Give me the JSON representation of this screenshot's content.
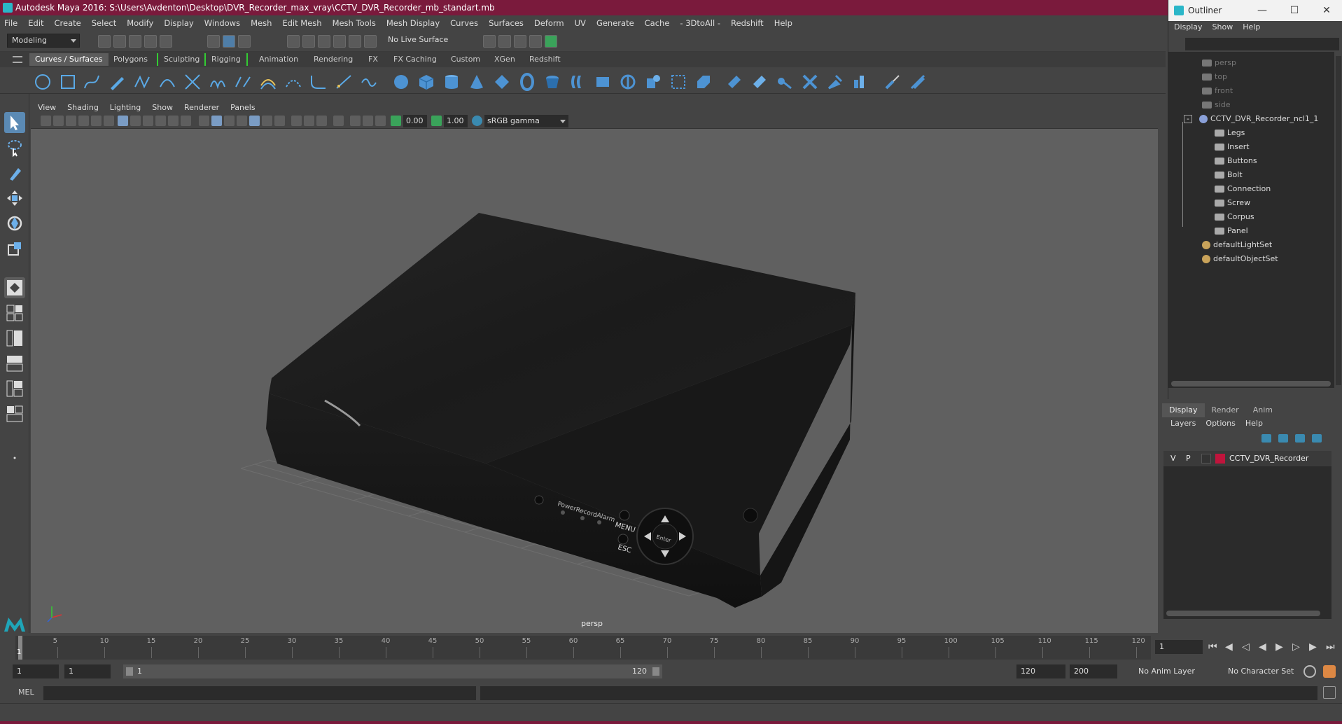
{
  "window": {
    "title": "Autodesk Maya 2016: S:\\Users\\Avdenton\\Desktop\\DVR_Recorder_max_vray\\CCTV_DVR_Recorder_mb_standart.mb"
  },
  "menubar": {
    "items": [
      "File",
      "Edit",
      "Create",
      "Select",
      "Modify",
      "Display",
      "Windows",
      "Mesh",
      "Edit Mesh",
      "Mesh Tools",
      "Mesh Display",
      "Curves",
      "Surfaces",
      "Deform",
      "UV",
      "Generate",
      "Cache",
      "- 3DtoAll -",
      "Redshift",
      "Help"
    ]
  },
  "statusline": {
    "mode": "Modeling",
    "live_surface": "No Live Surface"
  },
  "shelf": {
    "tabs": [
      "Curves / Surfaces",
      "Polygons",
      "Sculpting",
      "Rigging",
      "Animation",
      "Rendering",
      "FX",
      "FX Caching",
      "Custom",
      "XGen",
      "Redshift"
    ],
    "active_tab": "Curves / Surfaces"
  },
  "viewport": {
    "menu": [
      "View",
      "Shading",
      "Lighting",
      "Show",
      "Renderer",
      "Panels"
    ],
    "near_value": "0.00",
    "far_value": "1.00",
    "color_space": "sRGB gamma",
    "camera": "persp",
    "model_labels": {
      "power": "Power",
      "record": "Record",
      "alarm": "Alarm",
      "menu": "MENU",
      "esc": "ESC",
      "enter": "Enter"
    }
  },
  "outliner": {
    "title": "Outliner",
    "menu": [
      "Display",
      "Show",
      "Help"
    ],
    "items": [
      {
        "label": "persp",
        "dim": true,
        "indent": 0
      },
      {
        "label": "top",
        "dim": true,
        "indent": 0
      },
      {
        "label": "front",
        "dim": true,
        "indent": 0
      },
      {
        "label": "side",
        "dim": true,
        "indent": 0
      },
      {
        "label": "CCTV_DVR_Recorder_ncl1_1",
        "dim": false,
        "indent": 0
      },
      {
        "label": "Legs",
        "dim": false,
        "indent": 1
      },
      {
        "label": "Insert",
        "dim": false,
        "indent": 1
      },
      {
        "label": "Buttons",
        "dim": false,
        "indent": 1
      },
      {
        "label": "Bolt",
        "dim": false,
        "indent": 1
      },
      {
        "label": "Connection",
        "dim": false,
        "indent": 1
      },
      {
        "label": "Screw",
        "dim": false,
        "indent": 1
      },
      {
        "label": "Corpus",
        "dim": false,
        "indent": 1
      },
      {
        "label": "Panel",
        "dim": false,
        "indent": 1
      },
      {
        "label": "defaultLightSet",
        "dim": false,
        "indent": 0
      },
      {
        "label": "defaultObjectSet",
        "dim": false,
        "indent": 0
      }
    ]
  },
  "layers": {
    "tabs": [
      "Display",
      "Render",
      "Anim"
    ],
    "active_tab": "Display",
    "menu": [
      "Layers",
      "Options",
      "Help"
    ],
    "rows": [
      {
        "v": "V",
        "p": "P",
        "name": "CCTV_DVR_Recorder",
        "color": "#c0143c"
      }
    ]
  },
  "timeline": {
    "ticks": [
      5,
      10,
      15,
      20,
      25,
      30,
      35,
      40,
      45,
      50,
      55,
      60,
      65,
      70,
      75,
      80,
      85,
      90,
      95,
      100,
      105,
      110,
      115,
      120
    ],
    "current_frame_marker": "1",
    "current_frame": "1"
  },
  "range": {
    "start": "1",
    "playback_start": "1",
    "slider_start": "1",
    "slider_end": "120",
    "playback_end": "120",
    "end": "200",
    "anim_layer": "No Anim Layer",
    "character_set": "No Character Set"
  },
  "cmdline": {
    "label": "MEL"
  },
  "colors": {
    "titlebar": "#7a1a3c",
    "viewport_bg": "#606060",
    "selection": "#5b8ab4",
    "accent": "#2ab6c8"
  }
}
